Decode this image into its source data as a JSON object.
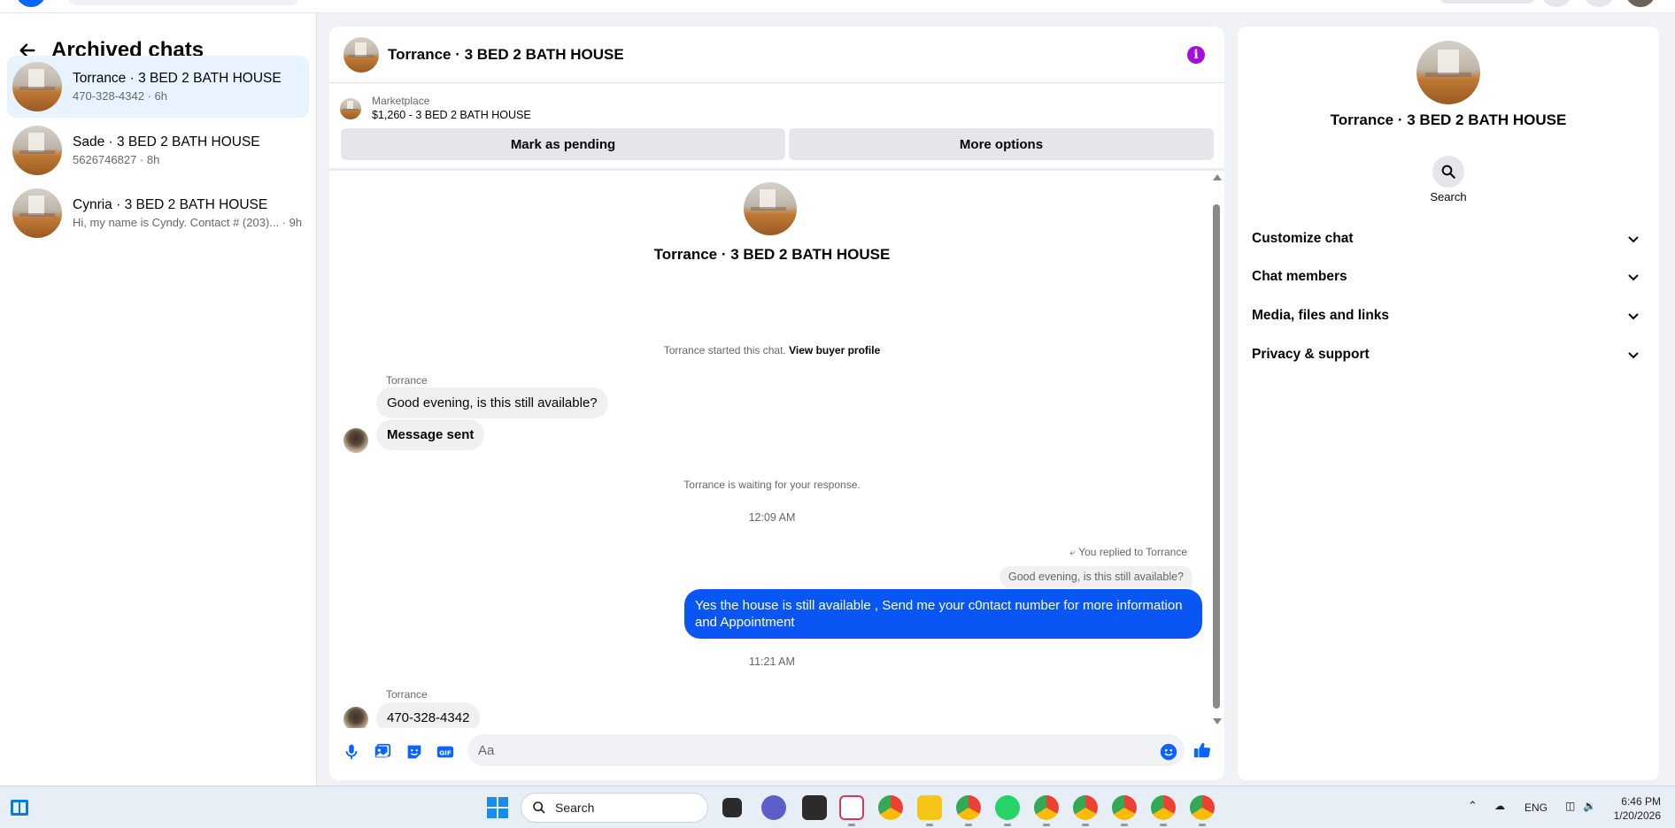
{
  "sidebar": {
    "title": "Archived chats",
    "chats": [
      {
        "name": "Torrance · 3 BED 2 BATH HOUSE",
        "sub": "470-328-4342 · 6h"
      },
      {
        "name": "Sade · 3 BED 2 BATH HOUSE",
        "sub": "5626746827 · 8h"
      },
      {
        "name": "Cynria · 3 BED 2 BATH HOUSE",
        "sub": "Hi, my name is Cyndy. Contact # (203)... · 9h"
      }
    ]
  },
  "conversation": {
    "title": "Torrance · 3 BED 2 BATH HOUSE",
    "marketplace_label": "Marketplace",
    "listing": "$1,260 - 3 BED 2 BATH HOUSE",
    "mark_pending": "Mark as pending",
    "more_options": "More options",
    "center_name": "Torrance · 3 BED 2 BATH HOUSE",
    "started_text": "Torrance started this chat.",
    "view_profile": "View buyer profile",
    "sender1": "Torrance",
    "msg1": "Good evening, is this still available?",
    "msg2": "Message sent",
    "waiting": "Torrance is waiting for your response.",
    "time1": "12:09 AM",
    "replied_to": "You replied to Torrance",
    "quoted": "Good evening, is this still available?",
    "sent_msg": "Yes the house is still available , Send me your c0ntact number for more information and Appointment",
    "time2": "11:21 AM",
    "sender2": "Torrance",
    "msg3": "470-328-4342",
    "composer_placeholder": "Aa"
  },
  "right_panel": {
    "name": "Torrance · 3 BED 2 BATH HOUSE",
    "search_label": "Search",
    "sections": [
      "Customize chat",
      "Chat members",
      "Media, files and links",
      "Privacy & support"
    ]
  },
  "taskbar": {
    "search": "Search",
    "lang": "ENG",
    "time": "6:46 PM",
    "date": "1/20/2026"
  },
  "colors": {
    "accent": "#0866ff",
    "sent_bubble": "#0a56f5",
    "info_icon": "#a40ed8",
    "active_item": "#e7f3ff"
  }
}
